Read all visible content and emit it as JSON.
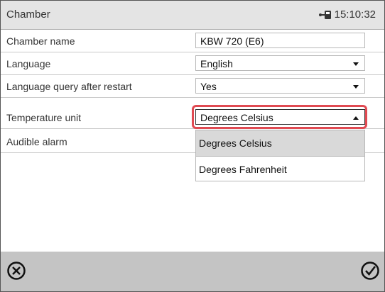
{
  "header": {
    "title": "Chamber",
    "time": "15:10:32",
    "status_icon": "network-icon"
  },
  "settings": {
    "rows": [
      {
        "label": "Chamber name",
        "value": "KBW 720 (E6)",
        "control": "text"
      },
      {
        "label": "Language",
        "value": "English",
        "control": "dropdown"
      },
      {
        "label": "Language query after restart",
        "value": "Yes",
        "control": "dropdown"
      },
      {
        "label": "Temperature unit",
        "value": "Degrees Celsius",
        "control": "dropdown-open"
      },
      {
        "label": "Audible alarm",
        "value": "",
        "control": "dropdown"
      }
    ]
  },
  "dropdown": {
    "options": [
      "Degrees Celsius",
      "Degrees Fahrenheit"
    ],
    "selected": "Degrees Celsius"
  },
  "footer": {
    "cancel_icon": "cancel-icon",
    "confirm_icon": "confirm-icon"
  },
  "colors": {
    "highlight": "#e04a52",
    "footer_bg": "#c4c4c4",
    "title_bg": "#e4e4e4"
  }
}
